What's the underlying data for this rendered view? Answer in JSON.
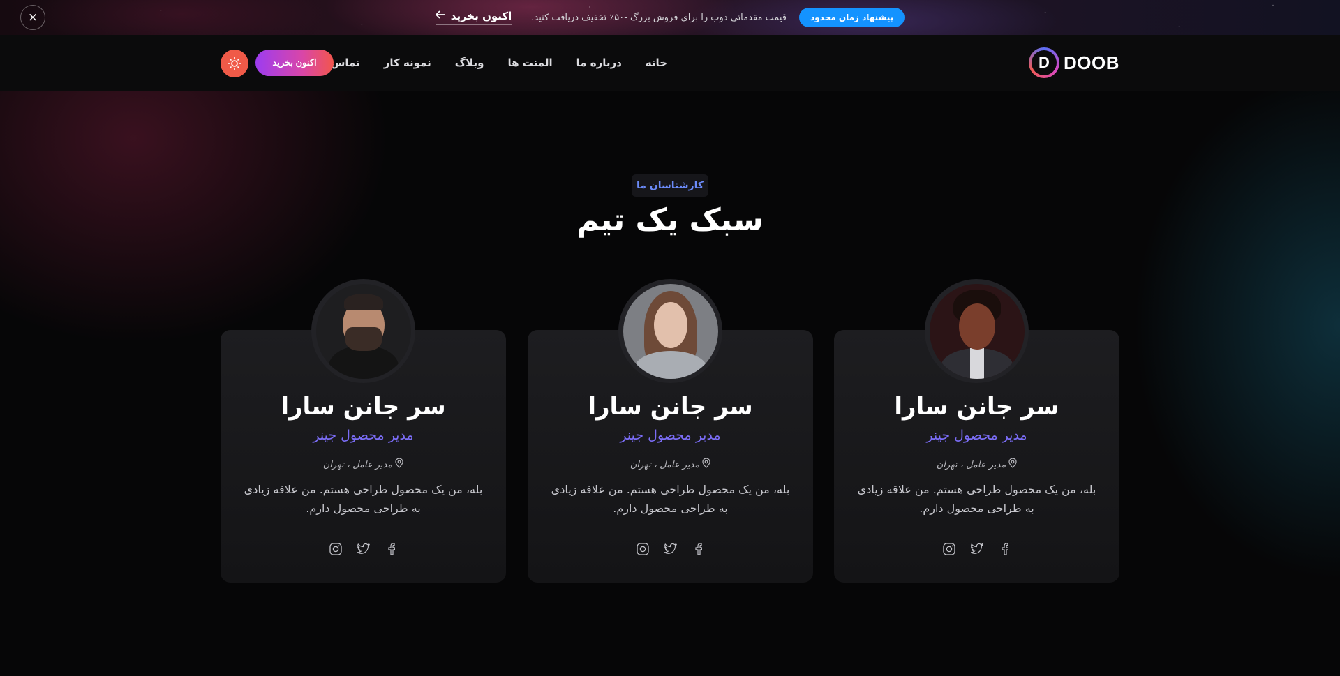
{
  "promo": {
    "badge": "پیشنهاد زمان محدود",
    "text": "قیمت مقدماتی دوب را برای فروش بزرگ -۵۰٪ تخفیف دریافت کنید.",
    "link": "اکنون بخرید",
    "close": "×"
  },
  "header": {
    "logo_letter": "D",
    "logo_text": "DOOB",
    "nav": [
      "خانه",
      "درباره ما",
      "المنت ها",
      "وبلاگ",
      "نمونه کار",
      "تماس"
    ],
    "buy_label": "اکنون بخرید"
  },
  "section": {
    "tag": "کارشناسان ما",
    "title": "سبک یک تیم"
  },
  "cards": [
    {
      "name": "سر جانن سارا",
      "role": "مدیر محصول جینر",
      "location": "مدیر عامل ، تهران",
      "description": "بله، من یک محصول طراحی هستم. من علاقه زیادی به طراحی محصول دارم."
    },
    {
      "name": "سر جانن سارا",
      "role": "مدیر محصول جینر",
      "location": "مدیر عامل ، تهران",
      "description": "بله، من یک محصول طراحی هستم. من علاقه زیادی به طراحی محصول دارم."
    },
    {
      "name": "سر جانن سارا",
      "role": "مدیر محصول جینر",
      "location": "مدیر عامل ، تهران",
      "description": "بله، من یک محصول طراحی هستم. من علاقه زیادی به طراحی محصول دارم."
    }
  ],
  "colors": {
    "accent_blue": "#1493ff",
    "role_text": "#7b6df7",
    "button_gradient_start": "#9d3cf0",
    "button_gradient_end": "#f2564d",
    "theme_button": "#f05a48"
  },
  "icons": [
    "close-icon",
    "arrow-left-icon",
    "sun-icon",
    "map-pin-icon",
    "facebook-icon",
    "twitter-icon",
    "instagram-icon"
  ]
}
